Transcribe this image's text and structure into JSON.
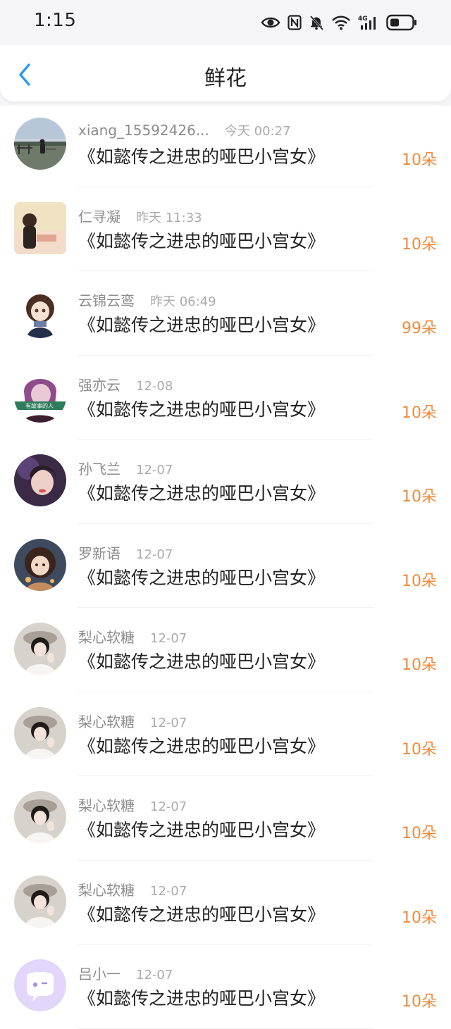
{
  "status_bar": {
    "time": "1:15",
    "icons": [
      "eye-icon",
      "nfc-icon",
      "bell-off-icon",
      "wifi-icon",
      "signal-4g-icon",
      "battery-icon"
    ]
  },
  "nav": {
    "back_icon": "chevron-left-icon",
    "title": "鲜花"
  },
  "colors": {
    "accent": "#2b9af3",
    "amount": "#f08a3c",
    "meta_text": "#9a9a9a",
    "header_bg": "#f5f5f7"
  },
  "items": [
    {
      "name": "xiang_15592426...",
      "time": "今天 00:27",
      "book": "《如懿传之进忠的哑巴小宫女》",
      "amount": "10朵"
    },
    {
      "name": "仁寻凝",
      "time": "昨天 11:33",
      "book": "《如懿传之进忠的哑巴小宫女》",
      "amount": "10朵"
    },
    {
      "name": "云锦云鸾",
      "time": "昨天 06:49",
      "book": "《如懿传之进忠的哑巴小宫女》",
      "amount": "99朵"
    },
    {
      "name": "强亦云",
      "time": "12-08",
      "book": "《如懿传之进忠的哑巴小宫女》",
      "amount": "10朵"
    },
    {
      "name": "孙飞兰",
      "time": "12-07",
      "book": "《如懿传之进忠的哑巴小宫女》",
      "amount": "10朵"
    },
    {
      "name": "罗新语",
      "time": "12-07",
      "book": "《如懿传之进忠的哑巴小宫女》",
      "amount": "10朵"
    },
    {
      "name": "梨心软糖",
      "time": "12-07",
      "book": "《如懿传之进忠的哑巴小宫女》",
      "amount": "10朵"
    },
    {
      "name": "梨心软糖",
      "time": "12-07",
      "book": "《如懿传之进忠的哑巴小宫女》",
      "amount": "10朵"
    },
    {
      "name": "梨心软糖",
      "time": "12-07",
      "book": "《如懿传之进忠的哑巴小宫女》",
      "amount": "10朵"
    },
    {
      "name": "梨心软糖",
      "time": "12-07",
      "book": "《如懿传之进忠的哑巴小宫女》",
      "amount": "10朵"
    },
    {
      "name": "吕小一",
      "time": "12-07",
      "book": "《如懿传之进忠的哑巴小宫女》",
      "amount": "10朵"
    }
  ],
  "avatar_labels": {
    "item_1": "",
    "item_3": "有故事的人"
  }
}
